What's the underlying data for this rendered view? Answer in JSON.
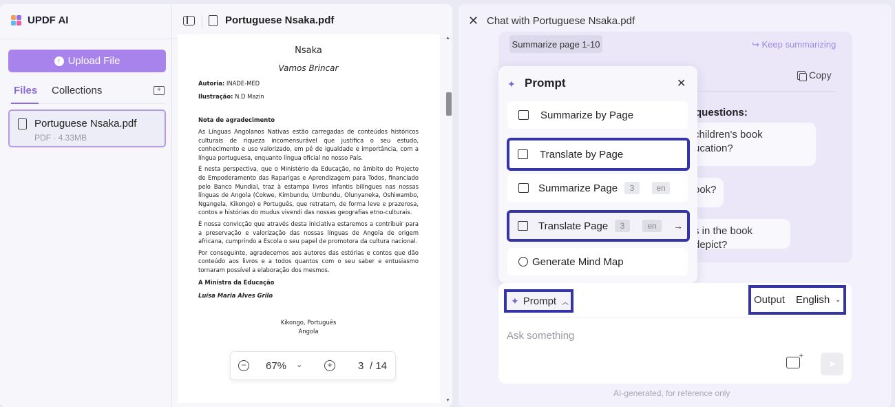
{
  "sidebar": {
    "brand": "UPDF AI",
    "upload_label": "Upload File",
    "tabs": {
      "files": "Files",
      "collections": "Collections"
    },
    "file": {
      "name": "Portuguese Nsaka.pdf",
      "meta": "PDF · 4.33MB"
    }
  },
  "document": {
    "title": "Portuguese Nsaka.pdf",
    "page": {
      "title": "Nsaka",
      "subtitle": "Vamos Brincar",
      "author_label": "Autoria:",
      "author": "INADE-MED",
      "illustration_label": "Ilustração:",
      "illustration": "N.D Mazin",
      "section": "Nota de agradecimento",
      "paragraphs": [
        "As Línguas Angolanos Nativas estão carregadas de conteúdos históricos culturais de riqueza incomensurável que justifica o seu estudo, conhecimento e uso valorizado, em pé de igualdade e importância, com a língua portuguesa, enquanto língua oficial no nosso País.",
        "É nesta perspectiva, que o Ministério da Educação, no âmbito do Projecto de Empoderamento das Raparigas e Aprendizagem para Todos, financiado pelo Banco Mundial, traz à estampa livros infantis bilíngues nas nossas línguas de Angola (Cokwe, Kimbundu, Umbundu, Olunyaneka, Oshiwambo, Ngangela, Kikongo) e Português, que retratam, de forma leve e prazerosa, contos e histórias do mudus vivendi das nossas geografias etno-culturais.",
        "É nossa convicção que através desta iniciativa estaremos a contribuir para a preservação e valorização das nossas línguas de Angola de origem africana, cumprindo a Escola o seu papel de promotora da cultura nacional.",
        "Por conseguinte, agradecemos aos autores das estórias e contos que dão conteúdo aos livros e a todos quantos com o seu saber e entusiasmo tornaram possível a elaboração dos mesmos."
      ],
      "signature_title": "A Ministra da Educação",
      "signature_name": "Luísa Maria Alves Grilo",
      "place_line1": "Kikongo, Português",
      "place_line2": "Angola"
    },
    "zoom": "67%",
    "current_page": "3",
    "total_pages": "/ 14"
  },
  "chat": {
    "title": "Chat with Portuguese Nsaka.pdf",
    "summarize_chip": "Summarize page 1-10",
    "keep_summarizing": "Keep summarizing",
    "copy": "Copy",
    "questions_label": "questions:",
    "questions": [
      "children's book\nucation?",
      "ook?",
      "s in the book depict?"
    ],
    "prompt_popup": {
      "title": "Prompt",
      "items": [
        {
          "label": "Summarize by Page"
        },
        {
          "label": "Translate by Page"
        },
        {
          "label": "Summarize Page",
          "page": "3",
          "lang": "en"
        },
        {
          "label": "Translate Page",
          "page": "3",
          "lang": "en"
        },
        {
          "label": "Generate Mind Map"
        }
      ]
    },
    "input": {
      "prompt_label": "Prompt",
      "output_label": "Output",
      "language": "English",
      "placeholder": "Ask something"
    },
    "footer": "AI-generated, for reference only"
  },
  "colors": {
    "accent": "#a983ec",
    "highlight_border": "#3434a6",
    "link": "#a08ae2"
  }
}
